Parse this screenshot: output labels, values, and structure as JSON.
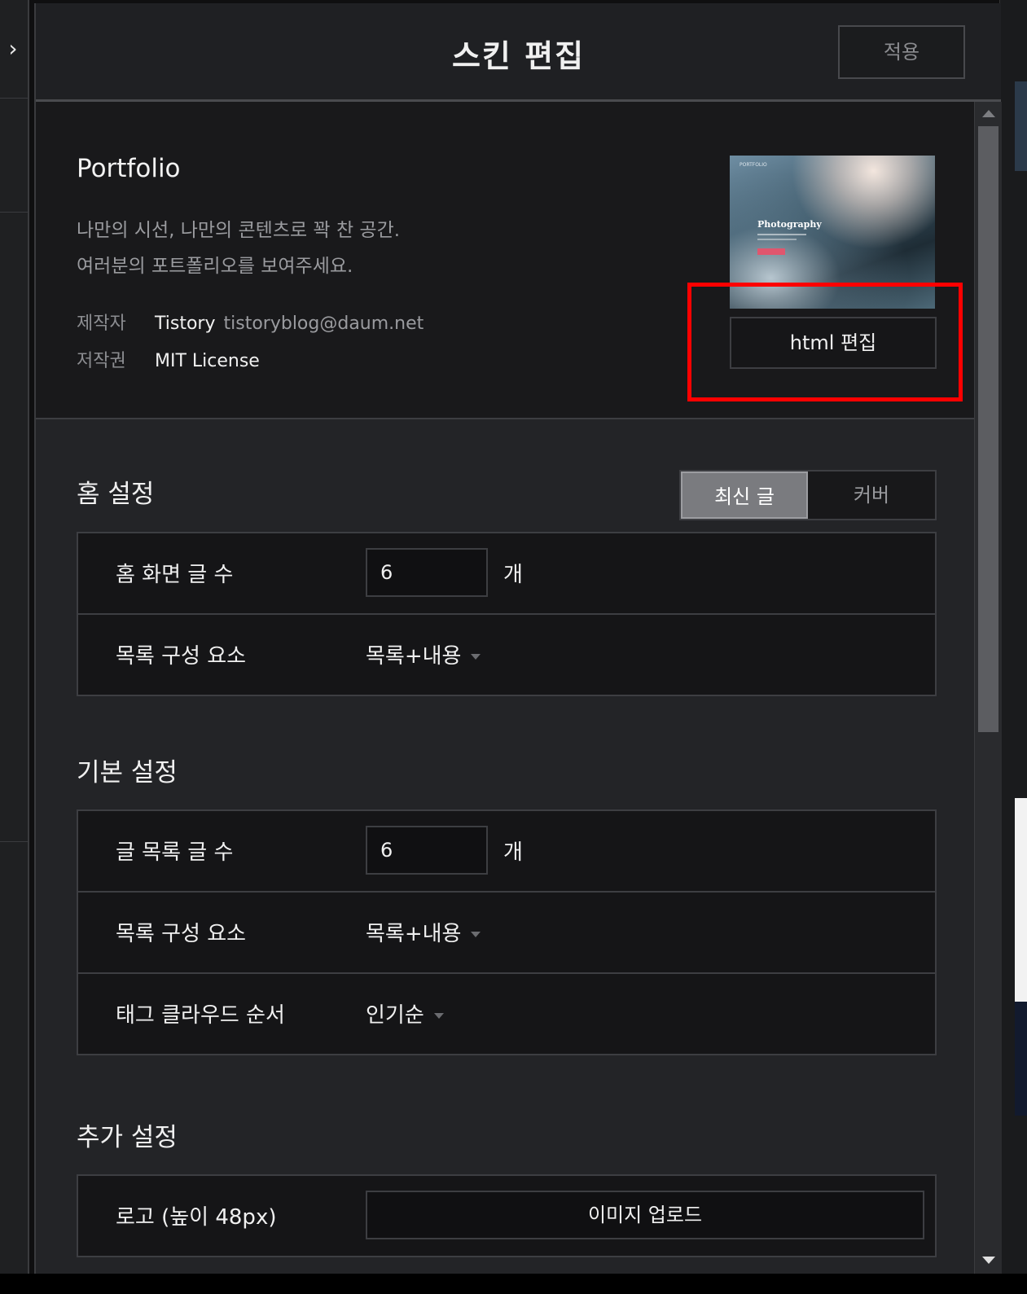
{
  "header": {
    "title": "스킨 편집",
    "apply_label": "적용"
  },
  "skin": {
    "name": "Portfolio",
    "desc_line1": "나만의 시선, 나만의 콘텐츠로 꽉 찬 공간.",
    "desc_line2": "여러분의 포트폴리오를 보여주세요.",
    "author_key": "제작자",
    "author_name": "Tistory",
    "author_email": "tistoryblog@daum.net",
    "license_key": "저작권",
    "license_value": "MIT License",
    "thumb_small": "PORTFOLIO",
    "thumb_big": "Photography",
    "html_edit_label": "html 편집"
  },
  "home": {
    "title": "홈 설정",
    "toggle": {
      "active": "최신 글",
      "inactive": "커버"
    },
    "rows": {
      "count_label": "홈 화면 글 수",
      "count_value": "6",
      "count_unit": "개",
      "list_label": "목록 구성 요소",
      "list_value": "목록+내용"
    }
  },
  "basic": {
    "title": "기본 설정",
    "rows": {
      "count_label": "글 목록 글 수",
      "count_value": "6",
      "count_unit": "개",
      "list_label": "목록 구성 요소",
      "list_value": "목록+내용",
      "tag_label": "태그 클라우드 순서",
      "tag_value": "인기순"
    }
  },
  "extra": {
    "title": "추가 설정",
    "rows": {
      "logo_label": "로고 (높이 48px)",
      "upload_label": "이미지 업로드"
    }
  },
  "colors": {
    "highlight": "#ff0000",
    "panel_bg": "#232427",
    "info_bg": "#19191b"
  }
}
